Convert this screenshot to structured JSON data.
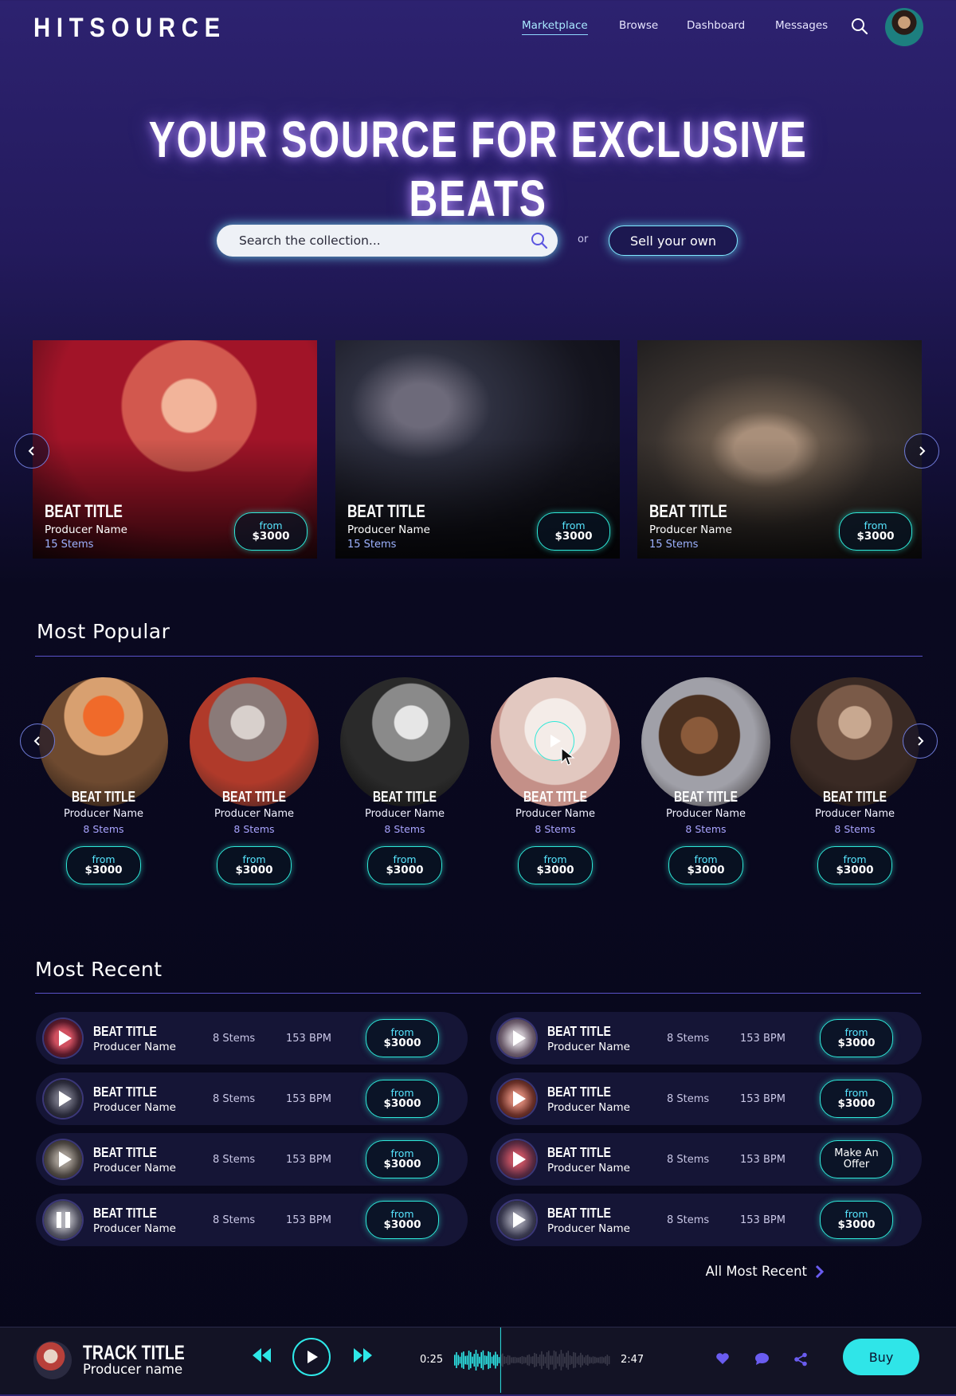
{
  "header": {
    "logo": "HITSOURCE",
    "nav": [
      {
        "label": "Marketplace"
      },
      {
        "label": "Browse"
      },
      {
        "label": "Dashboard"
      },
      {
        "label": "Messages"
      }
    ],
    "icons": {
      "search": "search-icon",
      "avatar": "user-avatar"
    }
  },
  "hero": {
    "title": "YOUR SOURCE FOR EXCLUSIVE BEATS",
    "search_placeholder": "Search the collection...",
    "or_label": "or",
    "sell_label": "Sell your own"
  },
  "featured": [
    {
      "title": "BEAT TITLE",
      "producer": "Producer Name",
      "stems": "15 Stems",
      "price_from": "from",
      "price": "$3000"
    },
    {
      "title": "BEAT TITLE",
      "producer": "Producer Name",
      "stems": "15 Stems",
      "price_from": "from",
      "price": "$3000"
    },
    {
      "title": "BEAT TITLE",
      "producer": "Producer Name",
      "stems": "15 Stems",
      "price_from": "from",
      "price": "$3000"
    }
  ],
  "most_popular": {
    "title": "Most Popular",
    "items": [
      {
        "title": "BEAT TITLE",
        "producer": "Producer Name",
        "stems": "8 Stems",
        "price_from": "from",
        "price": "$3000"
      },
      {
        "title": "BEAT TITLE",
        "producer": "Producer Name",
        "stems": "8 Stems",
        "price_from": "from",
        "price": "$3000"
      },
      {
        "title": "BEAT TITLE",
        "producer": "Producer Name",
        "stems": "8 Stems",
        "price_from": "from",
        "price": "$3000"
      },
      {
        "title": "BEAT TITLE",
        "producer": "Producer Name",
        "stems": "8 Stems",
        "price_from": "from",
        "price": "$3000"
      },
      {
        "title": "BEAT TITLE",
        "producer": "Producer Name",
        "stems": "8 Stems",
        "price_from": "from",
        "price": "$3000"
      },
      {
        "title": "BEAT TITLE",
        "producer": "Producer Name",
        "stems": "8 Stems",
        "price_from": "from",
        "price": "$3000"
      }
    ]
  },
  "most_recent": {
    "title": "Most Recent",
    "all_label": "All Most Recent",
    "rows": [
      {
        "title": "BEAT TITLE",
        "producer": "Producer Name",
        "stems": "8 Stems",
        "bpm": "153 BPM",
        "price_from": "from",
        "price": "$3000",
        "state": "play"
      },
      {
        "title": "BEAT TITLE",
        "producer": "Producer Name",
        "stems": "8 Stems",
        "bpm": "153 BPM",
        "price_from": "from",
        "price": "$3000",
        "state": "play"
      },
      {
        "title": "BEAT TITLE",
        "producer": "Producer Name",
        "stems": "8 Stems",
        "bpm": "153 BPM",
        "price_from": "from",
        "price": "$3000",
        "state": "play"
      },
      {
        "title": "BEAT TITLE",
        "producer": "Producer Name",
        "stems": "8 Stems",
        "bpm": "153 BPM",
        "price_from": "from",
        "price": "$3000",
        "state": "play"
      },
      {
        "title": "BEAT TITLE",
        "producer": "Producer Name",
        "stems": "8 Stems",
        "bpm": "153 BPM",
        "price_from": "Make An",
        "price": "Offer",
        "state": "play"
      },
      {
        "title": "BEAT TITLE",
        "producer": "Producer Name",
        "stems": "8 Stems",
        "bpm": "153 BPM",
        "price_from": "from",
        "price": "$3000",
        "state": "play"
      },
      {
        "title": "BEAT TITLE",
        "producer": "Producer Name",
        "stems": "8 Stems",
        "bpm": "153 BPM",
        "price_from": "from",
        "price": "$3000",
        "state": "pause"
      },
      {
        "title": "BEAT TITLE",
        "producer": "Producer Name",
        "stems": "8 Stems",
        "bpm": "153 BPM",
        "price_from": "from",
        "price": "$3000",
        "state": "play"
      }
    ]
  },
  "player": {
    "track_title": "TRACK TITLE",
    "producer": "Producer name",
    "elapsed": "0:25",
    "duration": "2:47",
    "progress": 0.15,
    "buy_label": "Buy"
  },
  "colors": {
    "accent_cyan": "#2ee8d8",
    "accent_purple": "#7a6cf0",
    "background_top": "#2d2270",
    "background_bottom": "#07071a"
  }
}
